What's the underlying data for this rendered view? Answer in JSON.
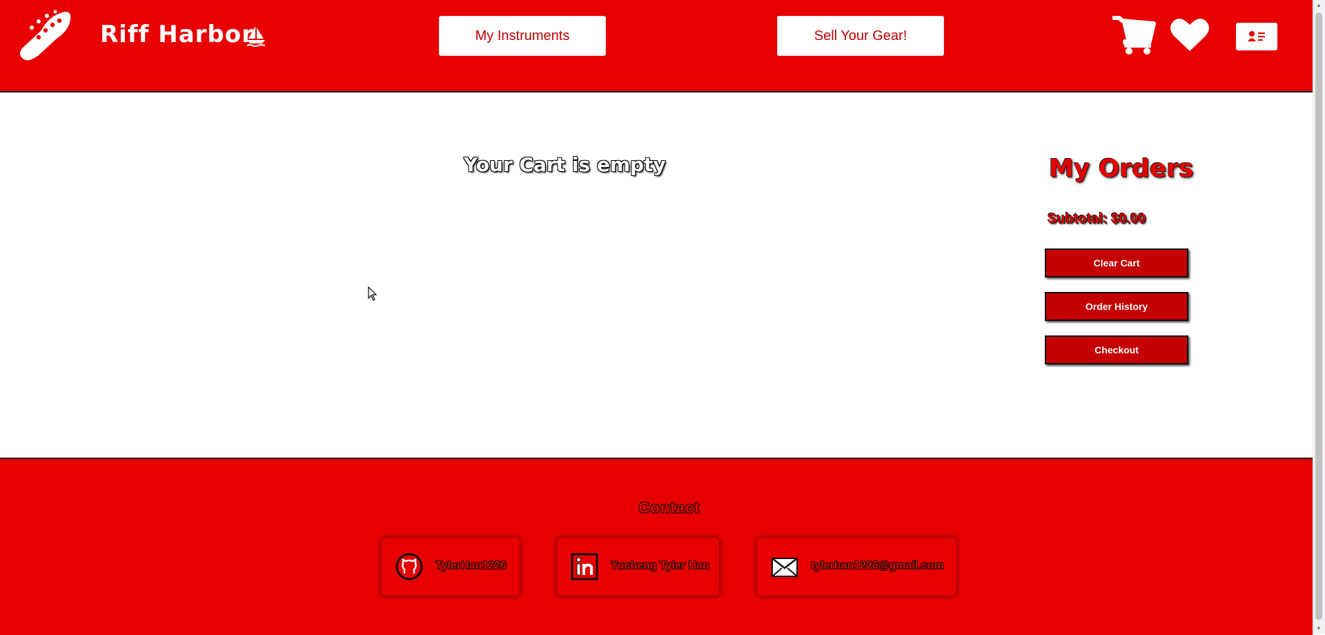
{
  "header": {
    "brand": "Riff Harbor",
    "nav": {
      "instruments_label": "My Instruments",
      "sell_label": "Sell Your Gear!"
    },
    "icons": {
      "logo": "guitar-headstock-icon",
      "boat": "sailboat-icon",
      "cart": "shopping-cart-icon",
      "favorites": "heart-icon",
      "profile": "profile-card-icon"
    }
  },
  "main": {
    "empty_message": "Your Cart is empty",
    "orders": {
      "title": "My Orders",
      "subtotal": "Subtotal: $0.00",
      "clear_label": "Clear Cart",
      "history_label": "Order History",
      "checkout_label": "Checkout"
    }
  },
  "footer": {
    "title": "Contact",
    "links": [
      {
        "icon": "github-icon",
        "label": "TylerHan1226"
      },
      {
        "icon": "linkedin-icon",
        "label": "Yucheng Tyler Han"
      },
      {
        "icon": "email-icon",
        "label": "tylerhan1226@gmail.com"
      }
    ]
  },
  "colors": {
    "brand_red": "#e80000",
    "button_red": "#c40000",
    "white": "#ffffff"
  }
}
